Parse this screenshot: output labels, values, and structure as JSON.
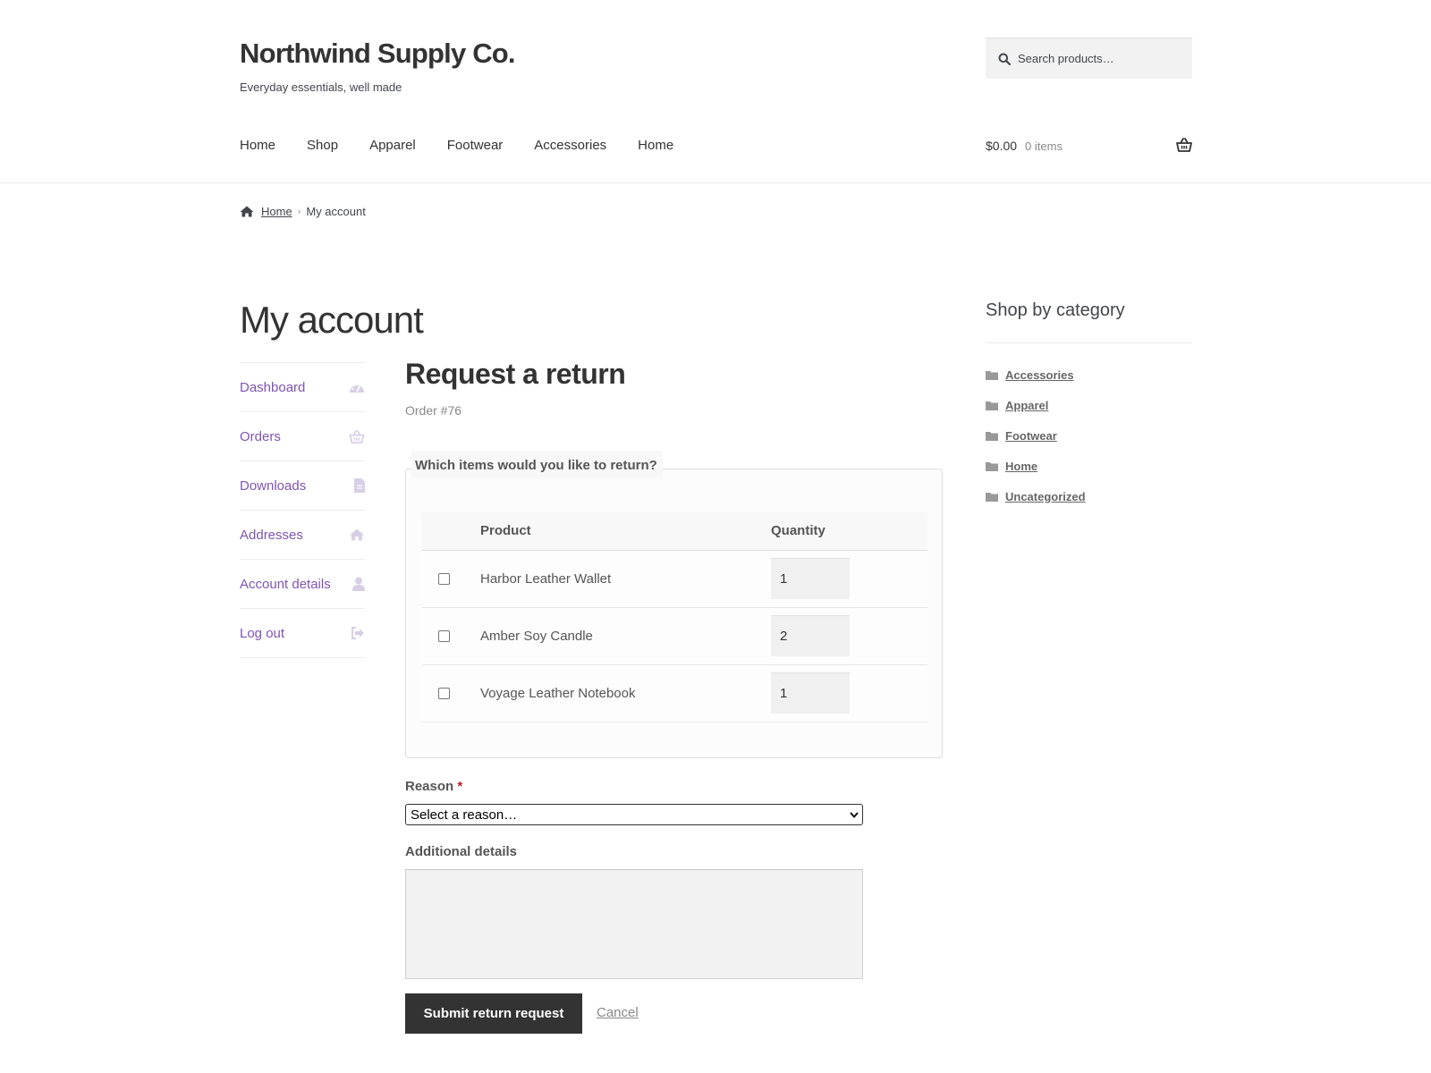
{
  "site": {
    "title": "Northwind Supply Co.",
    "tagline": "Everyday essentials, well made",
    "search_placeholder": "Search products…"
  },
  "nav": {
    "items": [
      "Home",
      "Shop",
      "Apparel",
      "Footwear",
      "Accessories",
      "Home"
    ]
  },
  "cart": {
    "amount": "$0.00",
    "count": "0 items"
  },
  "breadcrumb": {
    "home": "Home",
    "current": "My account"
  },
  "page": {
    "title": "My account"
  },
  "account_nav": [
    {
      "label": "Dashboard",
      "icon": "dashboard-icon"
    },
    {
      "label": "Orders",
      "icon": "basket-icon"
    },
    {
      "label": "Downloads",
      "icon": "file-icon"
    },
    {
      "label": "Addresses",
      "icon": "home-icon"
    },
    {
      "label": "Account details",
      "icon": "user-icon"
    },
    {
      "label": "Log out",
      "icon": "sign-out-icon"
    }
  ],
  "return_form": {
    "heading": "Request a return",
    "order_label": "Order #76",
    "legend": "Which items would you like to return?",
    "columns": [
      "Product",
      "Quantity"
    ],
    "items": [
      {
        "product": "Harbor Leather Wallet",
        "quantity": "1",
        "checked": false
      },
      {
        "product": "Amber Soy Candle",
        "quantity": "2",
        "checked": false
      },
      {
        "product": "Voyage Leather Notebook",
        "quantity": "1",
        "checked": false
      }
    ],
    "reason_label": "Reason",
    "required_marker": "*",
    "reason_selected": "Select a reason…",
    "details_label": "Additional details",
    "details_value": "",
    "submit_label": "Submit return request",
    "cancel_label": "Cancel"
  },
  "sidebar": {
    "title": "Shop by category",
    "categories": [
      "Accessories",
      "Apparel",
      "Footwear",
      "Home",
      "Uncategorized"
    ]
  },
  "colors": {
    "accent": "#7f54b3",
    "button": "#333333",
    "required": "#b81c23"
  }
}
